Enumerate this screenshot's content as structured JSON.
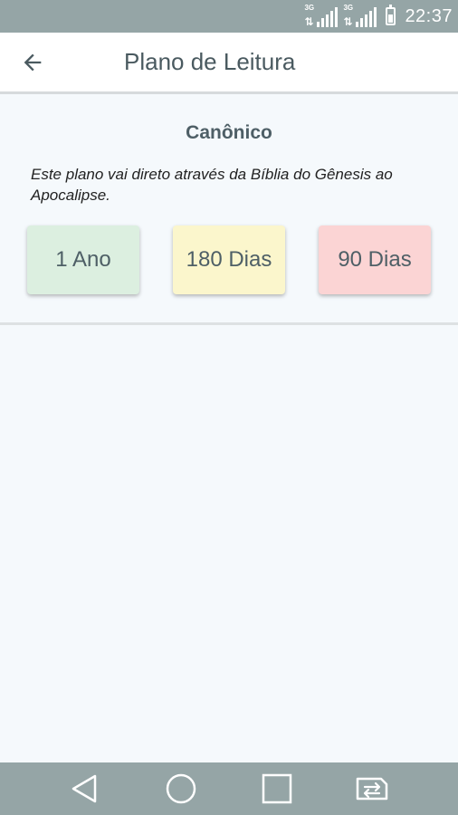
{
  "status_bar": {
    "network_1": "3G",
    "network_2": "3G",
    "time": "22:37"
  },
  "app_bar": {
    "title": "Plano de Leitura",
    "back_icon": "arrow-left-icon"
  },
  "plan": {
    "name": "Canônico",
    "description": "Este plano vai direto através da Bíblia do Gênesis ao Apocalipse.",
    "options": [
      {
        "label": "1 Ano",
        "color": "#dcefe0"
      },
      {
        "label": "180 Dias",
        "color": "#fbf6cc"
      },
      {
        "label": "90 Dias",
        "color": "#fbd4d4"
      }
    ]
  },
  "nav_bar": {
    "icons": [
      "back-triangle-icon",
      "home-circle-icon",
      "recents-square-icon",
      "switch-sim-icon"
    ]
  },
  "colors": {
    "status_bar": "#95a5a6",
    "nav_bar": "#95a5a6",
    "background": "#f5f9fc",
    "title_text": "#4a5a60"
  }
}
